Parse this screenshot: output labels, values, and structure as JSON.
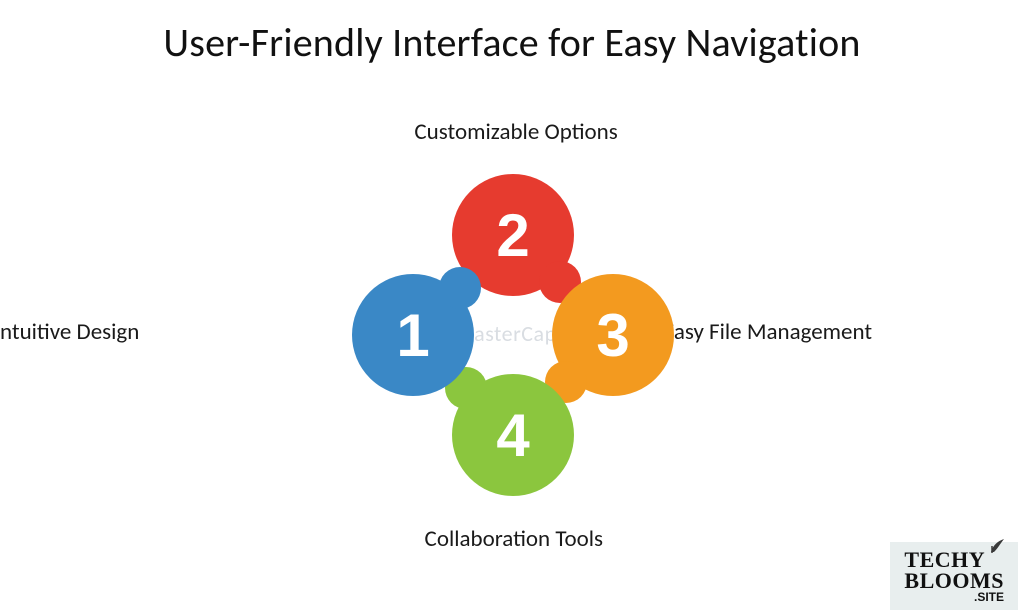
{
  "title": "User-Friendly Interface for Easy Navigation",
  "labels": {
    "top": "Customizable Options",
    "left": "ntuitive Design",
    "right": "Easy File Management",
    "bottom": "Collaboration Tools"
  },
  "nodes": {
    "top": {
      "num": "2",
      "color": "#e63b2f"
    },
    "right": {
      "num": "3",
      "color": "#f39a1f"
    },
    "bottom": {
      "num": "4",
      "color": "#8bc63e"
    },
    "left": {
      "num": "1",
      "color": "#3a88c6"
    }
  },
  "watermark": "FasterCapital",
  "site_badge": {
    "line1": "TECHY",
    "line2": "BLOOMS",
    "line3": ".SITE"
  }
}
